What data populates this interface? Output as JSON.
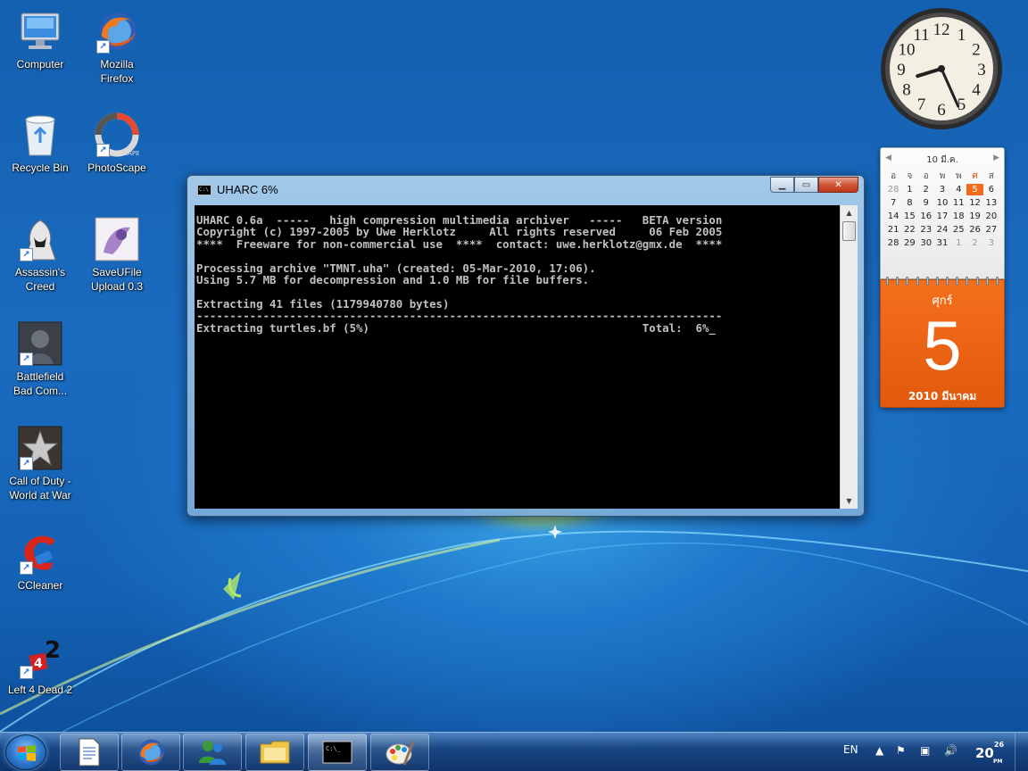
{
  "desktop_icons": [
    {
      "label": "Computer",
      "icon": "computer-icon"
    },
    {
      "label": "Mozilla\nFirefox",
      "icon": "firefox-icon"
    },
    {
      "label": "Recycle Bin",
      "icon": "recycle-bin-icon"
    },
    {
      "label": "PhotoScape",
      "icon": "photoscape-icon"
    },
    {
      "label": "Assassin's\nCreed",
      "icon": "assassins-creed-icon"
    },
    {
      "label": "SaveUFile\nUpload 0.3",
      "icon": "saveufile-icon"
    },
    {
      "label": "Battlefield\nBad Com...",
      "icon": "battlefield-icon"
    },
    {
      "label": "Call of Duty -\nWorld at War",
      "icon": "call-of-duty-icon"
    },
    {
      "label": "CCleaner",
      "icon": "ccleaner-icon"
    },
    {
      "label": "Left 4 Dead 2",
      "icon": "left4dead2-icon"
    }
  ],
  "clock": {
    "numerals": [
      "12",
      "1",
      "2",
      "3",
      "4",
      "5",
      "6",
      "7",
      "8",
      "9",
      "10",
      "11"
    ],
    "hour": 8,
    "minute": 26
  },
  "calendar": {
    "month_label": "10 มี.ค.",
    "weekdays": [
      "อ",
      "จ",
      "อ",
      "พ",
      "พ",
      "ศ",
      "ส"
    ],
    "weeks": [
      [
        "28",
        "1",
        "2",
        "3",
        "4",
        "5",
        "6"
      ],
      [
        "7",
        "8",
        "9",
        "10",
        "11",
        "12",
        "13"
      ],
      [
        "14",
        "15",
        "16",
        "17",
        "18",
        "19",
        "20"
      ],
      [
        "21",
        "22",
        "23",
        "24",
        "25",
        "26",
        "27"
      ],
      [
        "28",
        "29",
        "30",
        "31",
        "1",
        "2",
        "3"
      ]
    ],
    "row_prefix": [
      "1",
      "8",
      "15",
      "22",
      "29"
    ],
    "today": "5",
    "day_name": "ศุกร์",
    "day_number": "5",
    "month_year": "2010 มีนาคม",
    "accent": "#f26b1d"
  },
  "window": {
    "title": "UHARC  6%",
    "minimize": "▁",
    "maximize": "▭",
    "close": "✕",
    "console_lines": [
      "UHARC 0.6a  -----   high compression multimedia archiver   -----   BETA version",
      "Copyright (c) 1997-2005 by Uwe Herklotz     All rights reserved     06 Feb 2005",
      "****  Freeware for non-commercial use  ****  contact: uwe.herklotz@gmx.de  ****",
      "",
      "Processing archive \"TMNT.uha\" (created: 05-Mar-2010, 17:06).",
      "Using 5.7 MB for decompression and 1.0 MB for file buffers.",
      "",
      "Extracting 41 files (1179940780 bytes)",
      "-------------------------------------------------------------------------------",
      "Extracting turtles.bf (5%)                                         Total:  6%_"
    ]
  },
  "taskbar": {
    "buttons": [
      {
        "name": "documents",
        "icon": "document-icon"
      },
      {
        "name": "firefox",
        "icon": "firefox-icon"
      },
      {
        "name": "messenger",
        "icon": "messenger-icon"
      },
      {
        "name": "explorer",
        "icon": "folder-icon"
      },
      {
        "name": "console",
        "icon": "console-icon"
      },
      {
        "name": "paint",
        "icon": "paint-icon"
      }
    ],
    "language": "EN",
    "time_hour": "20",
    "time_minute": "26",
    "ampm": "PM"
  }
}
